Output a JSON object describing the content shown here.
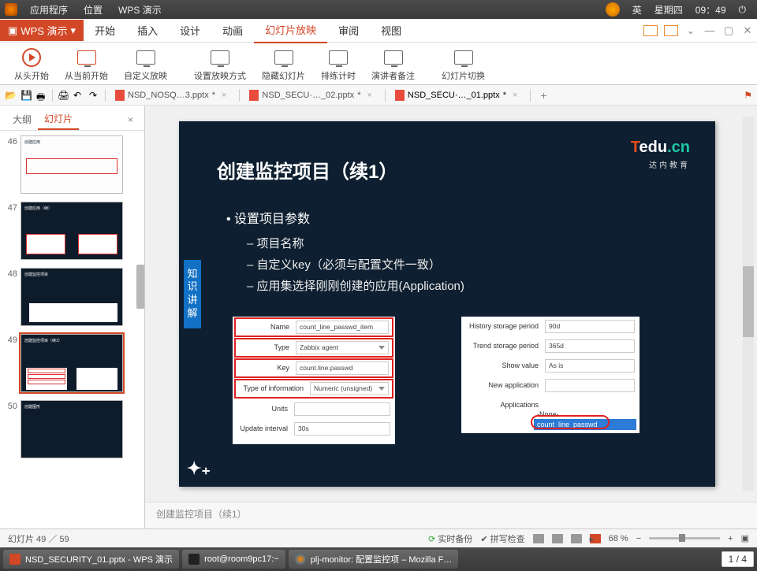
{
  "os_bar": {
    "apps_menu": "应用程序",
    "places_menu": "位置",
    "wps_menu": "WPS 演示",
    "ime": "英",
    "date": "星期四",
    "time": "09：49"
  },
  "app": {
    "title": "WPS 演示",
    "dropdown": "▾",
    "tabs": {
      "start": "开始",
      "insert": "插入",
      "design": "设计",
      "animation": "动画",
      "slideshow": "幻灯片放映",
      "review": "审阅",
      "view": "视图"
    }
  },
  "ribbon": {
    "from_beginning": "从头开始",
    "from_current": "从当前开始",
    "custom_show": "自定义放映",
    "set_show": "设置放映方式",
    "hide_slide": "隐藏幻灯片",
    "rehearse": "排练计时",
    "presenter": "演讲者备注",
    "switch": "幻灯片切换"
  },
  "docs": {
    "d1": "NSD_NOSQ…3.pptx",
    "d2": "NSD_SECU·…_02.pptx",
    "d3": "NSD_SECU·…_01.pptx"
  },
  "side": {
    "outline": "大纲",
    "slides": "幻灯片",
    "nums": [
      "46",
      "47",
      "48",
      "49",
      "50"
    ]
  },
  "slide": {
    "brand_main_t": "T",
    "brand_main_rest": "edu",
    "brand_main_cn": ".cn",
    "brand_sub": "达内教育",
    "title": "创建监控项目（续1）",
    "bullet1": "• 设置项目参数",
    "bullet2a": "– 项目名称",
    "bullet2b": "– 自定义key（必须与配置文件一致）",
    "bullet2c": "– 应用集选择刚刚创建的应用(Application)",
    "side_label": "知识讲解",
    "watermark": "✦₊",
    "form_left": {
      "name_lbl": "Name",
      "name_val": "count_line_passwd_item",
      "type_lbl": "Type",
      "type_val": "Zabbix agent",
      "key_lbl": "Key",
      "key_val": "count.line.passwd",
      "info_lbl": "Type of information",
      "info_val": "Numeric (unsigned)",
      "units_lbl": "Units",
      "units_val": "",
      "interval_lbl": "Update interval",
      "interval_val": "30s"
    },
    "form_right": {
      "hist_lbl": "History storage period",
      "hist_val": "90d",
      "trend_lbl": "Trend storage period",
      "trend_val": "365d",
      "show_lbl": "Show value",
      "show_val": "As is",
      "newapp_lbl": "New application",
      "newapp_val": "",
      "apps_lbl": "Applications",
      "apps_none": "-None-",
      "apps_item": "count_line_passwd"
    },
    "caption": "创建监控项目（续1）"
  },
  "status": {
    "slide_count": "幻灯片 49 ／ 59",
    "realtime": "实时备份",
    "spellcheck": "拼写检查",
    "zoom": "68 %"
  },
  "task": {
    "t1": "NSD_SECURITY_01.pptx - WPS 演示",
    "t2": "root@room9pc17:~",
    "t3": "plj-monitor: 配置监控项 – Mozilla F…",
    "page": "1 / 4"
  }
}
